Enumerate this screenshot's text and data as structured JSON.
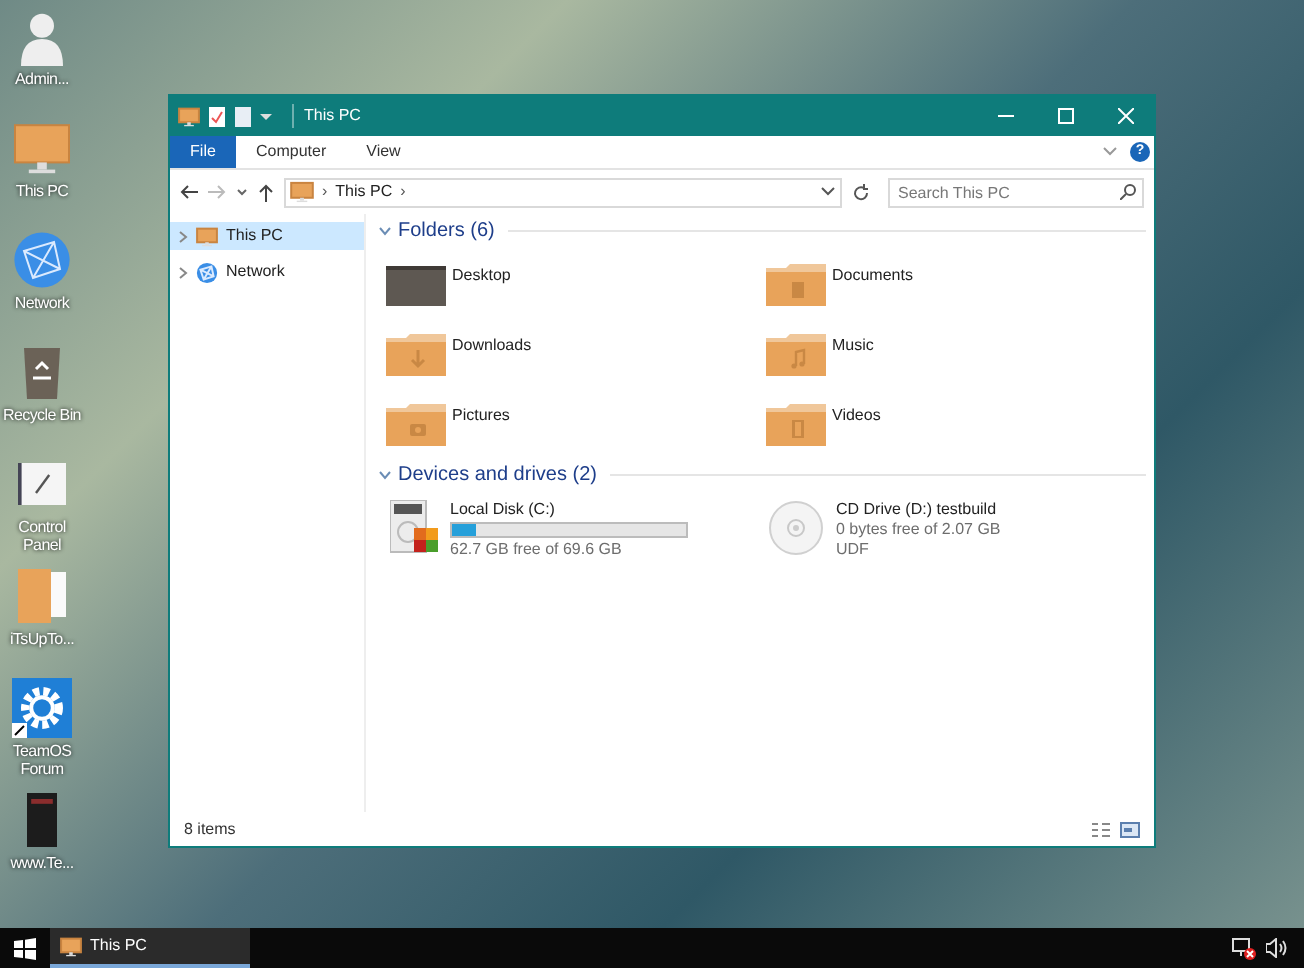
{
  "desktop_icons": [
    {
      "label": "Admin...",
      "kind": "user"
    },
    {
      "label": "This PC",
      "kind": "pc"
    },
    {
      "label": "Network",
      "kind": "globe"
    },
    {
      "label": "Recycle Bin",
      "kind": "recycle"
    },
    {
      "label": "Control Panel",
      "kind": "control"
    },
    {
      "label": "iTsUpTo...",
      "kind": "files"
    },
    {
      "label": "TeamOS Forum",
      "kind": "gear"
    },
    {
      "label": "www.Te...",
      "kind": "book"
    }
  ],
  "window": {
    "title": "This PC",
    "ribbon_tabs": [
      {
        "label": "File",
        "selected": true
      },
      {
        "label": "Computer",
        "selected": false
      },
      {
        "label": "View",
        "selected": false
      }
    ],
    "help": "?",
    "address": {
      "separator": "›",
      "path": "This PC",
      "trailing": "›"
    },
    "search": {
      "placeholder": "Search This PC"
    },
    "nav_items": [
      {
        "label": "This PC",
        "kind": "pc",
        "selected": true
      },
      {
        "label": "Network",
        "kind": "globe",
        "selected": false
      }
    ],
    "folders": {
      "heading": "Folders (6)",
      "items": [
        {
          "label": "Desktop",
          "kind": "desktop"
        },
        {
          "label": "Documents",
          "kind": "documents"
        },
        {
          "label": "Downloads",
          "kind": "downloads"
        },
        {
          "label": "Music",
          "kind": "music"
        },
        {
          "label": "Pictures",
          "kind": "pictures"
        },
        {
          "label": "Videos",
          "kind": "videos"
        }
      ]
    },
    "drives": {
      "heading": "Devices and drives (2)",
      "items": [
        {
          "label": "Local Disk (C:)",
          "kind": "disk",
          "level": 0.1,
          "detail": "62.7 GB free of 69.6 GB"
        },
        {
          "label": "CD Drive (D:) testbuild",
          "kind": "cd",
          "detail": "0 bytes free of 2.07 GB",
          "extra": "UDF"
        }
      ]
    },
    "status_bar": {
      "count": "8 items"
    }
  },
  "taskbar": {
    "items": [
      {
        "label": "This PC",
        "selected": true
      }
    ]
  }
}
